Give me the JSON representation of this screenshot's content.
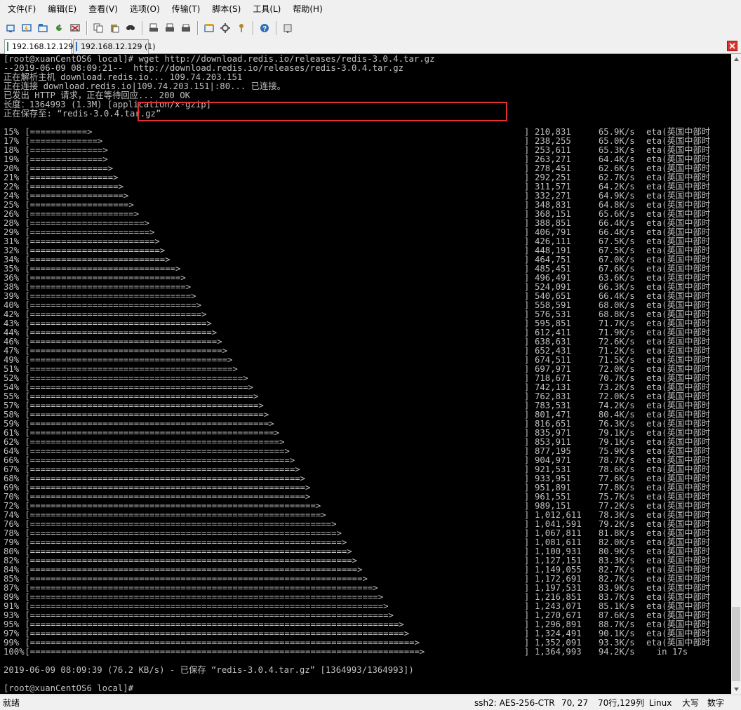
{
  "menubar": {
    "items": [
      "文件(F)",
      "编辑(E)",
      "查看(V)",
      "选项(O)",
      "传输(T)",
      "脚本(S)",
      "工具(L)",
      "帮助(H)"
    ]
  },
  "toolbar": {
    "buttons": [
      {
        "icon": "connect-icon",
        "color": "#2e6fb8"
      },
      {
        "icon": "quick-connect-icon",
        "color": "#2e6fb8"
      },
      {
        "icon": "connect-in-tab-icon",
        "color": "#2e6fb8"
      },
      {
        "icon": "reconnect-icon",
        "color": "#4a8d3e"
      },
      {
        "icon": "disconnect-icon",
        "color": "#c02020"
      },
      "sep",
      {
        "icon": "copy-icon",
        "color": "#555555"
      },
      {
        "icon": "paste-icon",
        "color": "#b08a30"
      },
      {
        "icon": "find-icon",
        "color": "#333333"
      },
      "sep",
      {
        "icon": "print-setup-icon",
        "color": "#555555"
      },
      {
        "icon": "print-icon",
        "color": "#555555"
      },
      {
        "icon": "print-screen-icon",
        "color": "#555555"
      },
      "sep",
      {
        "icon": "session-options-icon",
        "color": "#2e6fb8"
      },
      {
        "icon": "global-options-icon",
        "color": "#555555"
      },
      {
        "icon": "keymap-icon",
        "color": "#b08a30"
      },
      "sep",
      {
        "icon": "help-icon",
        "color": "#2e6fb8"
      },
      "sep",
      {
        "icon": "toolbar-more-icon",
        "color": "#555555"
      }
    ]
  },
  "tabs": [
    {
      "label": "192.168.12.129",
      "active": true,
      "mark_color": "#1fa34a"
    },
    {
      "label": "192.168.12.129 (1)",
      "active": false,
      "mark_color": "#2e6fb8"
    }
  ],
  "terminal": {
    "header_lines": [
      "[root@xuanCentOS6 local]# wget http://download.redis.io/releases/redis-3.0.4.tar.gz",
      "--2019-06-09 08:09:21--  http://download.redis.io/releases/redis-3.0.4.tar.gz",
      "正在解析主机 download.redis.io... 109.74.203.151",
      "正在连接 download.redis.io|109.74.203.151|:80... 已连接。",
      "已发出 HTTP 请求，正在等待回应... 200 OK",
      "长度：1364993 (1.3M) [application/x-gzip]",
      "正在保存至: “redis-3.0.4.tar.gz”",
      ""
    ],
    "progress": [
      {
        "pct": "15%",
        "bar": "[===========>",
        "bytes": "210,831",
        "rate": "65.9K/s",
        "eta": "eta(英国中部时"
      },
      {
        "pct": "17%",
        "bar": "[=============>",
        "bytes": "238,255",
        "rate": "65.0K/s",
        "eta": "eta(英国中部时"
      },
      {
        "pct": "18%",
        "bar": "[==============>",
        "bytes": "253,611",
        "rate": "65.3K/s",
        "eta": "eta(英国中部时"
      },
      {
        "pct": "19%",
        "bar": "[==============>",
        "bytes": "263,271",
        "rate": "64.4K/s",
        "eta": "eta(英国中部时"
      },
      {
        "pct": "20%",
        "bar": "[===============>",
        "bytes": "278,451",
        "rate": "62.6K/s",
        "eta": "eta(英国中部时"
      },
      {
        "pct": "21%",
        "bar": "[================>",
        "bytes": "292,251",
        "rate": "62.7K/s",
        "eta": "eta(英国中部时"
      },
      {
        "pct": "22%",
        "bar": "[=================>",
        "bytes": "311,571",
        "rate": "64.2K/s",
        "eta": "eta(英国中部时"
      },
      {
        "pct": "24%",
        "bar": "[==================>",
        "bytes": "332,271",
        "rate": "64.9K/s",
        "eta": "eta(英国中部时"
      },
      {
        "pct": "25%",
        "bar": "[===================>",
        "bytes": "348,831",
        "rate": "64.8K/s",
        "eta": "eta(英国中部时"
      },
      {
        "pct": "26%",
        "bar": "[====================>",
        "bytes": "368,151",
        "rate": "65.6K/s",
        "eta": "eta(英国中部时"
      },
      {
        "pct": "28%",
        "bar": "[======================>",
        "bytes": "388,851",
        "rate": "66.4K/s",
        "eta": "eta(英国中部时"
      },
      {
        "pct": "29%",
        "bar": "[=======================>",
        "bytes": "406,791",
        "rate": "66.4K/s",
        "eta": "eta(英国中部时"
      },
      {
        "pct": "31%",
        "bar": "[========================>",
        "bytes": "426,111",
        "rate": "67.5K/s",
        "eta": "eta(英国中部时"
      },
      {
        "pct": "32%",
        "bar": "[=========================>",
        "bytes": "448,191",
        "rate": "67.5K/s",
        "eta": "eta(英国中部时"
      },
      {
        "pct": "34%",
        "bar": "[==========================>",
        "bytes": "464,751",
        "rate": "67.0K/s",
        "eta": "eta(英国中部时"
      },
      {
        "pct": "35%",
        "bar": "[============================>",
        "bytes": "485,451",
        "rate": "67.6K/s",
        "eta": "eta(英国中部时"
      },
      {
        "pct": "36%",
        "bar": "[=============================>",
        "bytes": "496,491",
        "rate": "63.6K/s",
        "eta": "eta(英国中部时"
      },
      {
        "pct": "38%",
        "bar": "[==============================>",
        "bytes": "524,091",
        "rate": "66.3K/s",
        "eta": "eta(英国中部时"
      },
      {
        "pct": "39%",
        "bar": "[===============================>",
        "bytes": "540,651",
        "rate": "66.4K/s",
        "eta": "eta(英国中部时"
      },
      {
        "pct": "40%",
        "bar": "[================================>",
        "bytes": "558,591",
        "rate": "68.0K/s",
        "eta": "eta(英国中部时"
      },
      {
        "pct": "42%",
        "bar": "[=================================>",
        "bytes": "576,531",
        "rate": "68.8K/s",
        "eta": "eta(英国中部时"
      },
      {
        "pct": "43%",
        "bar": "[==================================>",
        "bytes": "595,851",
        "rate": "71.7K/s",
        "eta": "eta(英国中部时"
      },
      {
        "pct": "44%",
        "bar": "[===================================>",
        "bytes": "612,411",
        "rate": "71.9K/s",
        "eta": "eta(英国中部时"
      },
      {
        "pct": "46%",
        "bar": "[====================================>",
        "bytes": "638,631",
        "rate": "72.6K/s",
        "eta": "eta(英国中部时"
      },
      {
        "pct": "47%",
        "bar": "[=====================================>",
        "bytes": "652,431",
        "rate": "71.2K/s",
        "eta": "eta(英国中部时"
      },
      {
        "pct": "49%",
        "bar": "[======================================>",
        "bytes": "674,511",
        "rate": "71.5K/s",
        "eta": "eta(英国中部时"
      },
      {
        "pct": "51%",
        "bar": "[=======================================>",
        "bytes": "697,971",
        "rate": "72.0K/s",
        "eta": "eta(英国中部时"
      },
      {
        "pct": "52%",
        "bar": "[=========================================>",
        "bytes": "718,671",
        "rate": "70.7K/s",
        "eta": "eta(英国中部时"
      },
      {
        "pct": "54%",
        "bar": "[==========================================>",
        "bytes": "742,131",
        "rate": "73.2K/s",
        "eta": "eta(英国中部时"
      },
      {
        "pct": "55%",
        "bar": "[===========================================>",
        "bytes": "762,831",
        "rate": "72.0K/s",
        "eta": "eta(英国中部时"
      },
      {
        "pct": "57%",
        "bar": "[============================================>",
        "bytes": "783,531",
        "rate": "74.2K/s",
        "eta": "eta(英国中部时"
      },
      {
        "pct": "58%",
        "bar": "[=============================================>",
        "bytes": "801,471",
        "rate": "80.4K/s",
        "eta": "eta(英国中部时"
      },
      {
        "pct": "59%",
        "bar": "[==============================================>",
        "bytes": "816,651",
        "rate": "76.3K/s",
        "eta": "eta(英国中部时"
      },
      {
        "pct": "61%",
        "bar": "[===============================================>",
        "bytes": "835,971",
        "rate": "79.1K/s",
        "eta": "eta(英国中部时"
      },
      {
        "pct": "62%",
        "bar": "[================================================>",
        "bytes": "853,911",
        "rate": "79.1K/s",
        "eta": "eta(英国中部时"
      },
      {
        "pct": "64%",
        "bar": "[=================================================>",
        "bytes": "877,195",
        "rate": "75.9K/s",
        "eta": "eta(英国中部时"
      },
      {
        "pct": "66%",
        "bar": "[==================================================>",
        "bytes": "904,971",
        "rate": "78.7K/s",
        "eta": "eta(英国中部时"
      },
      {
        "pct": "67%",
        "bar": "[===================================================>",
        "bytes": "921,531",
        "rate": "78.6K/s",
        "eta": "eta(英国中部时"
      },
      {
        "pct": "68%",
        "bar": "[====================================================>",
        "bytes": "933,951",
        "rate": "77.6K/s",
        "eta": "eta(英国中部时"
      },
      {
        "pct": "69%",
        "bar": "[=====================================================>",
        "bytes": "951,891",
        "rate": "77.8K/s",
        "eta": "eta(英国中部时"
      },
      {
        "pct": "70%",
        "bar": "[=====================================================>",
        "bytes": "961,551",
        "rate": "75.7K/s",
        "eta": "eta(英国中部时"
      },
      {
        "pct": "72%",
        "bar": "[=======================================================>",
        "bytes": "989,151",
        "rate": "77.2K/s",
        "eta": "eta(英国中部时"
      },
      {
        "pct": "74%",
        "bar": "[========================================================>",
        "bytes": "1,012,611",
        "rate": "78.3K/s",
        "eta": "eta(英国中部时"
      },
      {
        "pct": "76%",
        "bar": "[==========================================================>",
        "bytes": "1,041,591",
        "rate": "79.2K/s",
        "eta": "eta(英国中部时"
      },
      {
        "pct": "78%",
        "bar": "[===========================================================>",
        "bytes": "1,067,811",
        "rate": "81.8K/s",
        "eta": "eta(英国中部时"
      },
      {
        "pct": "79%",
        "bar": "[============================================================>",
        "bytes": "1,081,611",
        "rate": "82.0K/s",
        "eta": "eta(英国中部时"
      },
      {
        "pct": "80%",
        "bar": "[=============================================================>",
        "bytes": "1,100,931",
        "rate": "80.9K/s",
        "eta": "eta(英国中部时"
      },
      {
        "pct": "82%",
        "bar": "[==============================================================>",
        "bytes": "1,127,151",
        "rate": "83.3K/s",
        "eta": "eta(英国中部时"
      },
      {
        "pct": "84%",
        "bar": "[===============================================================>",
        "bytes": "1,149,055",
        "rate": "82.7K/s",
        "eta": "eta(英国中部时"
      },
      {
        "pct": "85%",
        "bar": "[================================================================>",
        "bytes": "1,172,691",
        "rate": "82.7K/s",
        "eta": "eta(英国中部时"
      },
      {
        "pct": "87%",
        "bar": "[==================================================================>",
        "bytes": "1,197,531",
        "rate": "83.9K/s",
        "eta": "eta(英国中部时"
      },
      {
        "pct": "89%",
        "bar": "[===================================================================>",
        "bytes": "1,216,851",
        "rate": "83.7K/s",
        "eta": "eta(英国中部时"
      },
      {
        "pct": "91%",
        "bar": "[====================================================================>",
        "bytes": "1,243,071",
        "rate": "85.1K/s",
        "eta": "eta(英国中部时"
      },
      {
        "pct": "93%",
        "bar": "[=====================================================================>",
        "bytes": "1,270,671",
        "rate": "87.6K/s",
        "eta": "eta(英国中部时"
      },
      {
        "pct": "95%",
        "bar": "[=======================================================================>",
        "bytes": "1,296,891",
        "rate": "88.7K/s",
        "eta": "eta(英国中部时"
      },
      {
        "pct": "97%",
        "bar": "[========================================================================>",
        "bytes": "1,324,491",
        "rate": "90.1K/s",
        "eta": "eta(英国中部时"
      },
      {
        "pct": "99%",
        "bar": "[==========================================================================>",
        "bytes": "1,352,091",
        "rate": "93.3K/s",
        "eta": "eta(英国中部时"
      },
      {
        "pct": "100%",
        "bar": "[===========================================================================>",
        "bytes": "1,364,993",
        "rate": "94.2K/s",
        "eta": "  in 17s"
      }
    ],
    "footer_lines": [
      "",
      "2019-06-09 08:09:39 (76.2 KB/s) - 已保存 “redis-3.0.4.tar.gz” [1364993/1364993])",
      "",
      "[root@xuanCentOS6 local]#"
    ]
  },
  "statusbar": {
    "ready": "就绪",
    "encryption": "ssh2: AES-256-CTR",
    "cursor": "70,  27",
    "size": "70行,129列",
    "os": "Linux",
    "caps": "大写",
    "num": "数字"
  },
  "colors": {
    "terminal_bg": "#000000",
    "terminal_fg": "#c0c0c0",
    "highlight_box": "#e03030"
  }
}
